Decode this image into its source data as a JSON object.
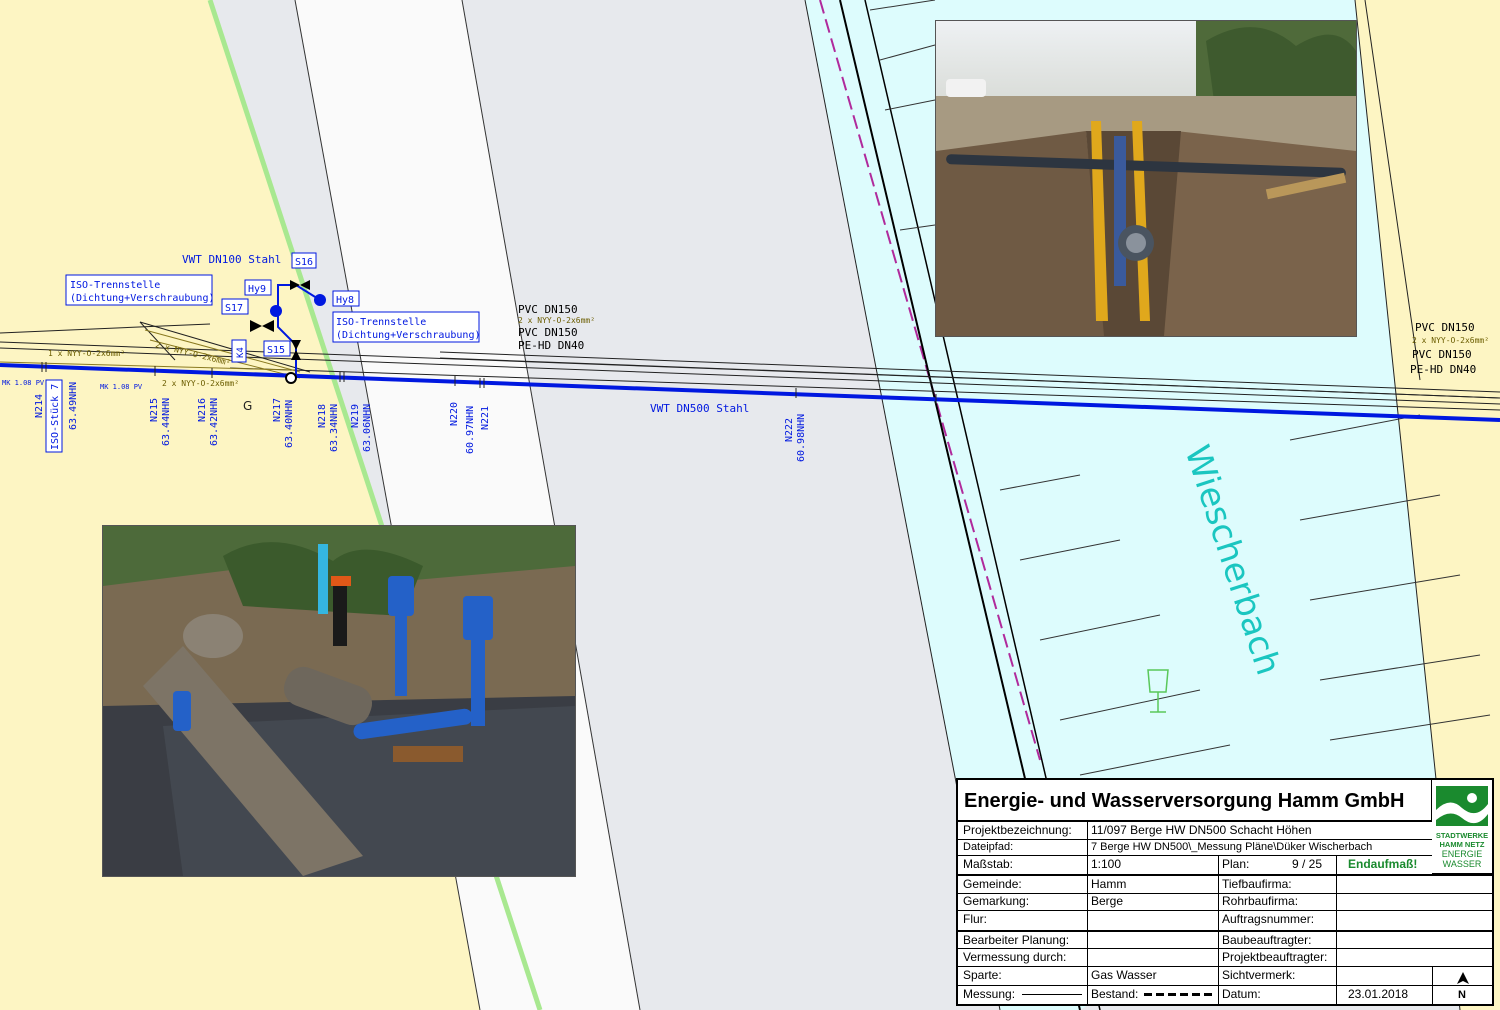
{
  "map": {
    "stream_name": "Wiescherbach",
    "main_pipe_label": "VWT DN500 Stahl",
    "branch_pipe_label": "VWT DN100 Stahl",
    "iso_label_1_line1": "ISO-Trennstelle",
    "iso_label_1_line2": "(Dichtung+Verschraubung)",
    "iso_label_2_line1": "ISO-Trennstelle",
    "iso_label_2_line2": "(Dichtung+Verschraubung)",
    "iso_piece_label": "ISO-Stück 7",
    "tags": {
      "s16": "S16",
      "hy9": "Hy9",
      "hy8": "Hy8",
      "s17": "S17",
      "s15": "S15",
      "k4": "K4"
    },
    "cable_labels": {
      "c1": "1 x NYY-O-2x6mm²",
      "c2": "2 x NYY-O-2x6mm²",
      "c3": "2 x NYY-O-2x6mm²",
      "c4": "2 x NYY-O-2x6mm²",
      "c5": "2 x NYY-O-2x6mm²"
    },
    "mk_labels": {
      "mk1": "MK 1.08 PV",
      "mk2": "MK 1.08 PV"
    },
    "pipe_group_left": {
      "l1": "PVC DN150",
      "l2": "PVC DN150",
      "l3": "PE-HD DN40"
    },
    "pipe_group_right": {
      "l1": "PVC DN150",
      "l2": "PVC DN150",
      "l3": "PE-HD DN40"
    },
    "points": [
      {
        "id": "N214",
        "height": ""
      },
      {
        "id": "",
        "height": "63.49NHN"
      },
      {
        "id": "N215",
        "height": "63.44NHN"
      },
      {
        "id": "N216",
        "height": "63.42NHN"
      },
      {
        "id": "N217",
        "height": "63.40NHN"
      },
      {
        "id": "N218",
        "height": "63.34NHN"
      },
      {
        "id": "N219",
        "height": "63.06NHN"
      },
      {
        "id": "N220",
        "height": "60.97NHN"
      },
      {
        "id": "N221",
        "height": ""
      },
      {
        "id": "N222",
        "height": "60.98NHN"
      }
    ],
    "colors": {
      "land": "#fdf5c3",
      "road": "#e7e9ed",
      "verge": "#fafafa",
      "water": "#ddfcfd",
      "main_pipe": "#0018e0",
      "stream_text": "#1ac6c0",
      "green_line": "#a8e890"
    }
  },
  "titleblock": {
    "company": "Energie-  und Wasserversorgung Hamm GmbH",
    "logo_text": {
      "l1": "STADTWERKE",
      "l2": "HAMM NETZ",
      "l3": "ENERGIE",
      "l4": "WASSER"
    },
    "fields": {
      "projektbezeichnung_label": "Projektbezeichnung:",
      "projektbezeichnung_value": "11/097  Berge  HW  DN500  Schacht  Höhen",
      "dateipfad_label": "Dateipfad:",
      "dateipfad_value": "7  Berge  HW  DN500\\_Messung  Pläne\\Düker  Wischerbach",
      "massstab_label": "Maßstab:",
      "massstab_value": "1:100",
      "plan_label": "Plan:",
      "plan_value": "9 / 25",
      "status": "Endaufmaß!",
      "gemeinde_label": "Gemeinde:",
      "gemeinde_value": "Hamm",
      "tiefbaufirma_label": "Tiefbaufirma:",
      "gemarkung_label": "Gemarkung:",
      "gemarkung_value": "Berge",
      "rohrbaufirma_label": "Rohrbaufirma:",
      "flur_label": "Flur:",
      "auftragsnummer_label": "Auftragsnummer:",
      "bearbeiter_label": "Bearbeiter Planung:",
      "baubeauftragter_label": "Baubeauftragter:",
      "vermessung_label": "Vermessung  durch:",
      "projektbeauftragter_label": "Projektbeauftragter:",
      "sparte_label": "Sparte:",
      "sparte_value": "Gas  Wasser",
      "sichtvermerk_label": "Sichtvermerk:",
      "messung_label": "Messung:",
      "bestand_label": "Bestand:",
      "datum_label": "Datum:",
      "datum_value": "23.01.2018"
    }
  }
}
